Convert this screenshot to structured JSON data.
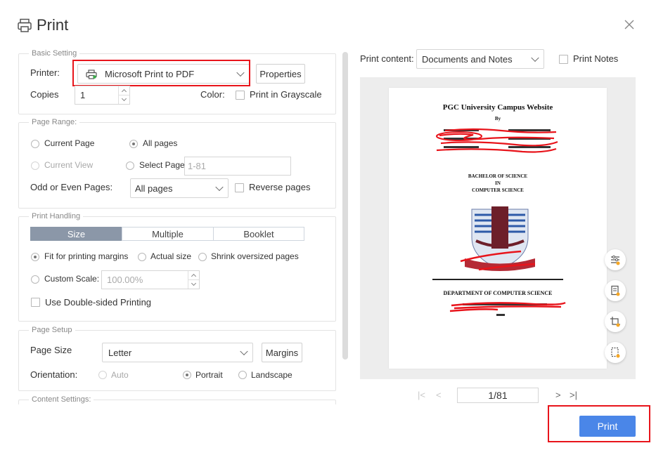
{
  "dialog": {
    "title": "Print"
  },
  "basic": {
    "label": "Basic Setting",
    "printer_label": "Printer:",
    "printer_value": "Microsoft Print to PDF",
    "properties": "Properties",
    "copies_label": "Copies",
    "copies_value": "1",
    "color_label": "Color:",
    "grayscale_label": "Print in Grayscale"
  },
  "range": {
    "label": "Page Range:",
    "current_page": "Current Page",
    "all_pages": "All pages",
    "current_view": "Current View",
    "select_page": "Select Page:",
    "select_placeholder": "1-81",
    "odd_even_label": "Odd or Even Pages:",
    "odd_even_value": "All pages",
    "reverse": "Reverse pages"
  },
  "handling": {
    "label": "Print Handling",
    "tabs": [
      "Size",
      "Multiple",
      "Booklet"
    ],
    "fit": "Fit for printing margins",
    "actual": "Actual size",
    "shrink": "Shrink oversized pages",
    "custom_scale": "Custom Scale:",
    "scale_value": "100.00%",
    "double_sided": "Use Double-sided Printing"
  },
  "setup": {
    "label": "Page Setup",
    "page_size_label": "Page Size",
    "page_size_value": "Letter",
    "margins": "Margins",
    "orientation_label": "Orientation:",
    "auto": "Auto",
    "portrait": "Portrait",
    "landscape": "Landscape"
  },
  "content_settings": {
    "label": "Content Settings:"
  },
  "preview": {
    "content_label": "Print content:",
    "content_value": "Documents and Notes",
    "print_notes": "Print Notes",
    "pager": "1/81",
    "doc": {
      "title": "PGC University Campus Website",
      "by": "By",
      "degree1": "BACHELOR OF SCIENCE",
      "degree2": "IN",
      "degree3": "COMPUTER SCIENCE",
      "dept": "DEPARTMENT OF COMPUTER SCIENCE"
    }
  },
  "actions": {
    "print": "Print"
  },
  "colors": {
    "accent": "#4a86e8",
    "highlight": "#e8141b",
    "tab_active": "#8b97a8"
  }
}
